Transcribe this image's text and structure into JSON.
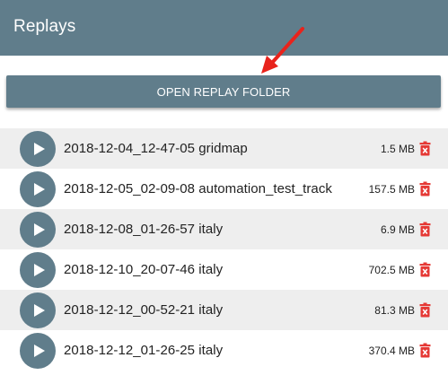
{
  "header": {
    "title": "Replays"
  },
  "open_folder_button": {
    "label": "OPEN REPLAY FOLDER"
  },
  "colors": {
    "header_bg": "#607d8b",
    "play_bg": "#607d8b",
    "delete_red": "#e53935",
    "annotation_arrow": "#e8231c"
  },
  "icons": {
    "play": "play-icon",
    "delete": "trash-icon",
    "annotation": "red-arrow-icon"
  },
  "replays": [
    {
      "name": "2018-12-04_12-47-05 gridmap",
      "size": "1.5 MB"
    },
    {
      "name": "2018-12-05_02-09-08 automation_test_track",
      "size": "157.5 MB"
    },
    {
      "name": "2018-12-08_01-26-57 italy",
      "size": "6.9 MB"
    },
    {
      "name": "2018-12-10_20-07-46 italy",
      "size": "702.5 MB"
    },
    {
      "name": "2018-12-12_00-52-21 italy",
      "size": "81.3 MB"
    },
    {
      "name": "2018-12-12_01-26-25 italy",
      "size": "370.4 MB"
    }
  ]
}
